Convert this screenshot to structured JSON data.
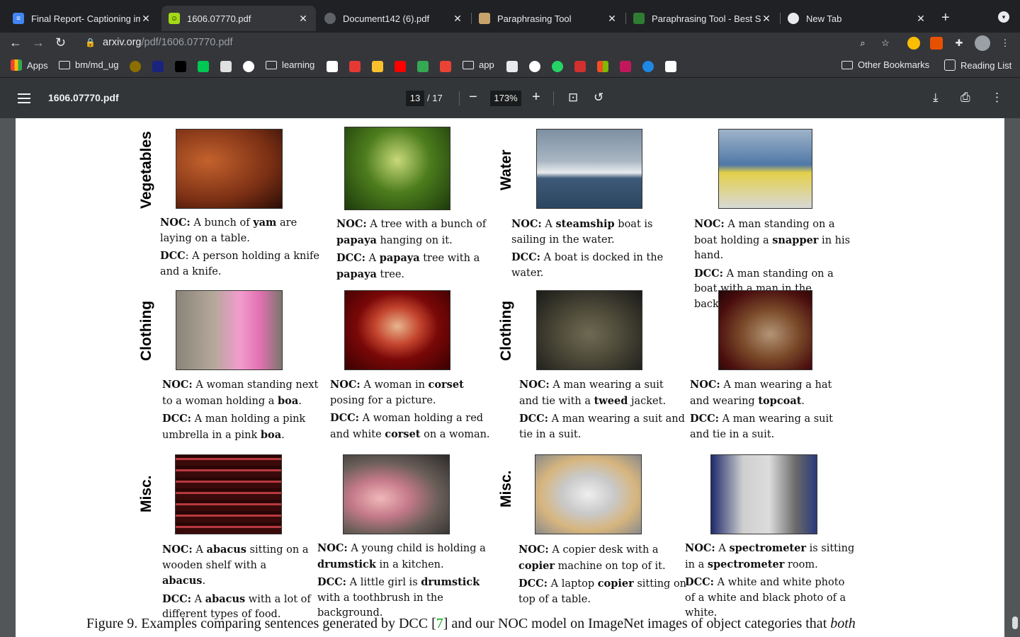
{
  "browser": {
    "tabs": [
      {
        "title": "Final Report- Captioning im",
        "color": "#4285f4",
        "active": false
      },
      {
        "title": "1606.07770.pdf",
        "color": "#a3d915",
        "active": true
      },
      {
        "title": "Document142 (6).pdf",
        "color": "#5f6368",
        "active": false
      },
      {
        "title": "Paraphrasing Tool",
        "color": "#c8a46b",
        "active": false
      },
      {
        "title": "Paraphrasing Tool - Best Sc",
        "color": "#2e7d32",
        "active": false
      },
      {
        "title": "New Tab",
        "color": "#e8eaed",
        "active": false
      }
    ],
    "url_host": "arxiv.org",
    "url_path": "/pdf/1606.07770.pdf",
    "bookmarks": {
      "apps": "Apps",
      "bm_md_ug": "bm/md_ug",
      "learning": "learning",
      "app": "app",
      "other": "Other Bookmarks",
      "reading_list": "Reading List"
    }
  },
  "pdf": {
    "title": "1606.07770.pdf",
    "page": "13",
    "total": "/ 17",
    "zoom": "173%"
  },
  "figure": {
    "row_labels": {
      "left_1": "Vegetables",
      "right_1": "Water",
      "left_2": "Clothing",
      "right_2": "Clothing",
      "left_3": "Misc.",
      "right_3": "Misc."
    },
    "caption_prefix": "Figure 9. Examples comparing sentences generated by DCC [",
    "caption_ref": "7",
    "caption_mid": "] and our NOC model on ImageNet images of object categories that ",
    "caption_italic": "both"
  }
}
